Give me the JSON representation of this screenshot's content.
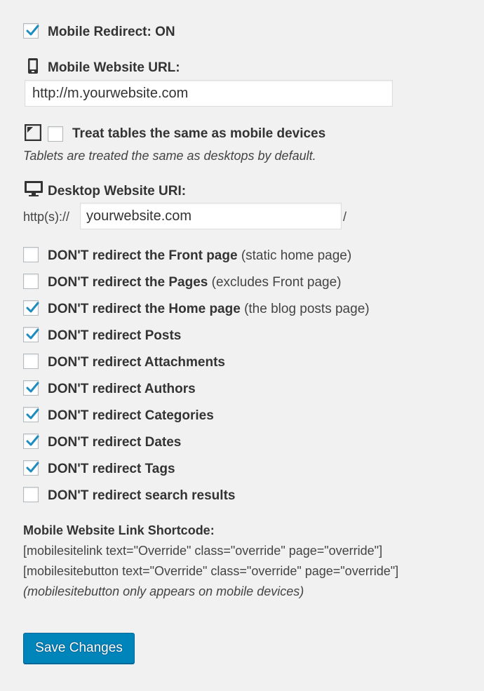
{
  "mobile_redirect": {
    "label": "Mobile Redirect: ON",
    "checked": true
  },
  "mobile_url": {
    "label": "Mobile Website URL:",
    "value": "http://m.yourwebsite.com",
    "icon": "mobile-phone-icon"
  },
  "tablets": {
    "label": "Treat tables the same as mobile devices",
    "checked": false,
    "note": "Tablets are treated the same as desktops by default.",
    "icon": "tablet-icon"
  },
  "desktop_uri": {
    "label": "Desktop Website URI:",
    "prefix": "http(s)://",
    "value": "yourwebsite.com",
    "suffix": "/",
    "icon": "desktop-icon"
  },
  "options": [
    {
      "label": "DON'T redirect the Front page",
      "extra": "(static home page)",
      "checked": false
    },
    {
      "label": "DON'T redirect the Pages",
      "extra": "(excludes Front page)",
      "checked": false
    },
    {
      "label": "DON'T redirect the Home page",
      "extra": "(the blog posts page)",
      "checked": true
    },
    {
      "label": "DON'T redirect Posts",
      "extra": "",
      "checked": true
    },
    {
      "label": "DON'T redirect Attachments",
      "extra": "",
      "checked": false
    },
    {
      "label": "DON'T redirect Authors",
      "extra": "",
      "checked": true
    },
    {
      "label": "DON'T redirect Categories",
      "extra": "",
      "checked": true
    },
    {
      "label": "DON'T redirect Dates",
      "extra": "",
      "checked": true
    },
    {
      "label": "DON'T redirect Tags",
      "extra": "",
      "checked": true
    },
    {
      "label": "DON'T redirect search results",
      "extra": "",
      "checked": false
    }
  ],
  "shortcode": {
    "heading": "Mobile Website Link Shortcode:",
    "line1": "[mobilesitelink text=\"Override\" class=\"override\" page=\"override\"]",
    "line2": "[mobilesitebutton text=\"Override\" class=\"override\" page=\"override\"]",
    "note": "(mobilesitebutton only appears on mobile devices)"
  },
  "save_button": {
    "label": "Save Changes"
  },
  "colors": {
    "check": "#1e8cbe",
    "button": "#0085ba",
    "text": "#444444"
  }
}
